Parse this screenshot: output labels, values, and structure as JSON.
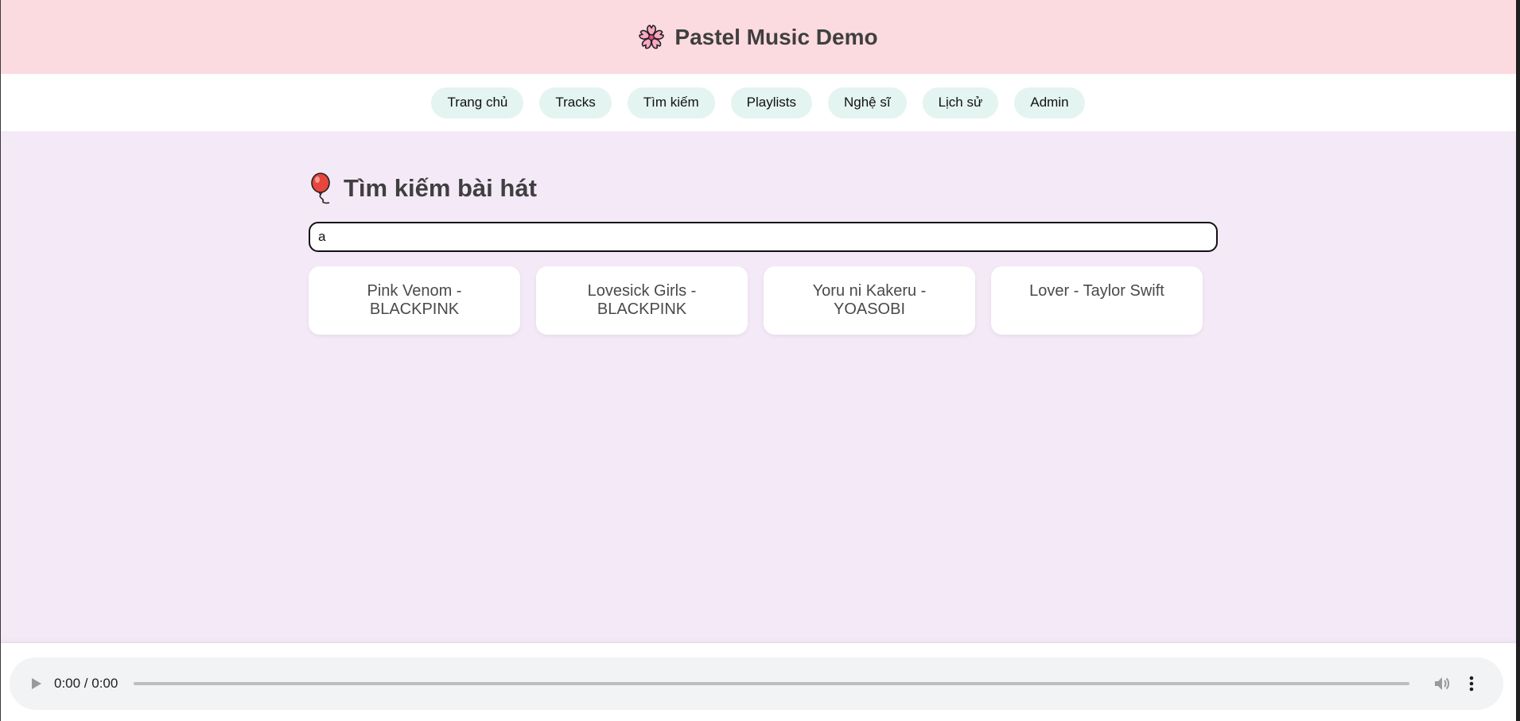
{
  "header": {
    "title": "Pastel Music Demo",
    "logo_icon": "cherry-blossom-icon"
  },
  "nav": {
    "items": [
      {
        "label": "Trang chủ"
      },
      {
        "label": "Tracks"
      },
      {
        "label": "Tìm kiếm"
      },
      {
        "label": "Playlists"
      },
      {
        "label": "Nghệ sĩ"
      },
      {
        "label": "Lịch sử"
      },
      {
        "label": "Admin"
      }
    ]
  },
  "search": {
    "heading": "Tìm kiếm bài hát",
    "heading_icon": "balloon-icon",
    "value": "a"
  },
  "results": [
    {
      "label": "Pink Venom - BLACKPINK"
    },
    {
      "label": "Lovesick Girls - BLACKPINK"
    },
    {
      "label": "Yoru ni Kakeru - YOASOBI"
    },
    {
      "label": "Lover - Taylor Swift"
    }
  ],
  "player": {
    "time": "0:00 / 0:00",
    "progress": 0
  },
  "colors": {
    "header_bg": "#fcdbe0",
    "nav_pill": "#e3f4f1",
    "content_bg": "#f4e9f7",
    "player_bg": "#f1f3f4"
  }
}
